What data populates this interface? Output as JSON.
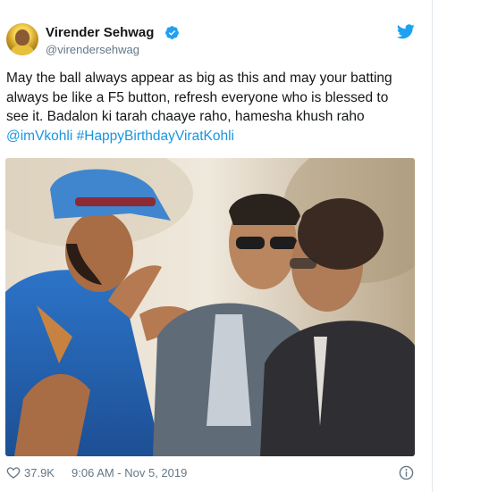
{
  "tweet": {
    "author": {
      "display_name": "Virender Sehwag",
      "handle": "@virendersehwag",
      "verified": true
    },
    "text_lines": [
      "May the ball always appear as big as this and may your batting",
      "always be like a F5 button, refresh everyone who is blessed to",
      "see it. Badalon ki tarah chaaye raho, hamesha khush raho"
    ],
    "mention": "@imVkohli",
    "hashtag": "#HappyBirthdayViratKohli",
    "likes": "37.9K",
    "timestamp": "9:06 AM - Nov 5, 2019"
  },
  "colors": {
    "link": "#1b95e0",
    "muted": "#657786",
    "text": "#14171a"
  },
  "icons": {
    "verified": "verified-badge-icon",
    "platform": "twitter-bird-icon",
    "like": "heart-icon",
    "info": "info-icon"
  }
}
